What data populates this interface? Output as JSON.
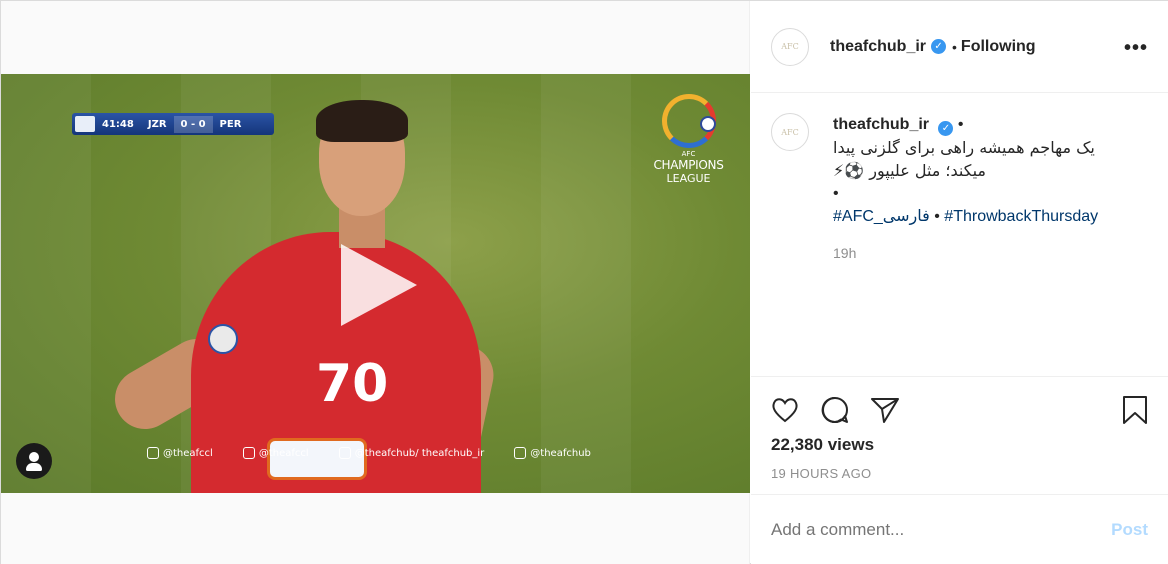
{
  "video": {
    "scoreboard": {
      "time": "41:48",
      "home": "JZR",
      "score": "0 - 0",
      "away": "PER"
    },
    "competition": {
      "line1": "AFC",
      "line2": "CHAMPIONS",
      "line3": "LEAGUE"
    },
    "shirt_number": "70",
    "social": [
      {
        "icon": "facebook-icon",
        "text": "@theafccl"
      },
      {
        "icon": "twitter-icon",
        "text": "@theafccl"
      },
      {
        "icon": "instagram-icon",
        "text": "@theafchub/ theafchub_ir"
      },
      {
        "icon": "youtube-icon",
        "text": "@theafchub"
      }
    ]
  },
  "header": {
    "username": "theafchub_ir",
    "verified": true,
    "separator": "•",
    "follow_state": "Following",
    "more": "•••"
  },
  "caption": {
    "username": "theafchub_ir",
    "separator": "•",
    "line1": "یک مهاجم همیشه راهی برای گلزنی پیدا",
    "line2": "میکند؛ مثل علیپور ⚽⚡",
    "line3": "•",
    "hashtag1": "#AFC_فارسی",
    "hashtag_sep": " • ",
    "hashtag2": "#ThrowbackThursday",
    "time": "19h"
  },
  "stats": {
    "views": "22,380 views",
    "ago": "19 HOURS AGO"
  },
  "comment": {
    "placeholder": "Add a comment...",
    "post_label": "Post"
  },
  "colors": {
    "link": "#00376b",
    "verified": "#3897f0",
    "post_button": "#b3dbff",
    "secondary_text": "#8e8e8e"
  }
}
